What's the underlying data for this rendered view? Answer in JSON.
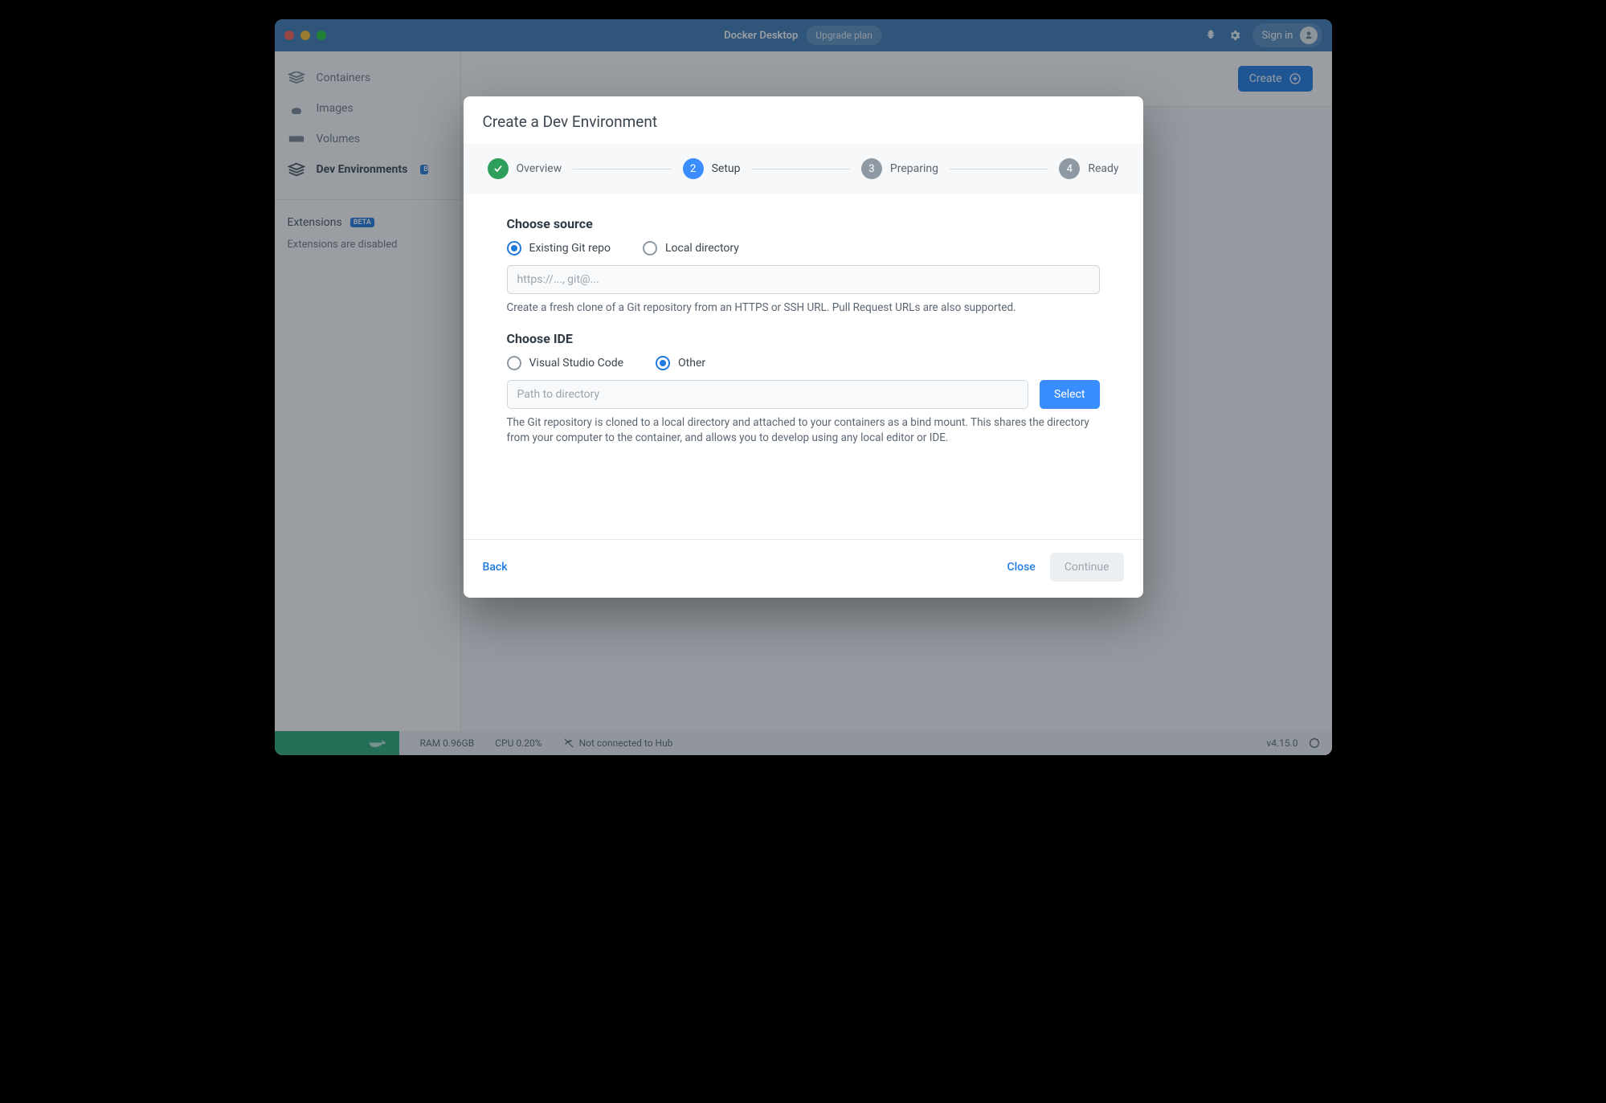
{
  "titlebar": {
    "app_title": "Docker Desktop",
    "upgrade_label": "Upgrade plan",
    "signin_label": "Sign in"
  },
  "sidebar": {
    "items": [
      {
        "label": "Containers"
      },
      {
        "label": "Images"
      },
      {
        "label": "Volumes"
      },
      {
        "label": "Dev Environments",
        "badge": "BETA"
      }
    ],
    "extensions_label": "Extensions",
    "extensions_badge": "BETA",
    "extensions_disabled": "Extensions are disabled"
  },
  "page": {
    "create_label": "Create"
  },
  "modal": {
    "title": "Create a Dev Environment",
    "steps": [
      {
        "label": "Overview"
      },
      {
        "label": "Setup",
        "num": "2"
      },
      {
        "label": "Preparing",
        "num": "3"
      },
      {
        "label": "Ready",
        "num": "4"
      }
    ],
    "source": {
      "title": "Choose source",
      "opt_git": "Existing Git repo",
      "opt_local": "Local directory",
      "placeholder": "https://..., git@...",
      "helper": "Create a fresh clone of a Git repository from an HTTPS or SSH URL. Pull Request URLs are also supported."
    },
    "ide": {
      "title": "Choose IDE",
      "opt_vscode": "Visual Studio Code",
      "opt_other": "Other",
      "placeholder": "Path to directory",
      "select_label": "Select",
      "helper": "The Git repository is cloned to a local directory and attached to your containers as a bind mount. This shares the directory from your computer to the container, and allows you to develop using any local editor or IDE."
    },
    "footer": {
      "back": "Back",
      "close": "Close",
      "continue": "Continue"
    }
  },
  "status": {
    "ram": "RAM 0.96GB",
    "cpu": "CPU 0.20%",
    "hub": "Not connected to Hub",
    "version": "v4.15.0"
  }
}
